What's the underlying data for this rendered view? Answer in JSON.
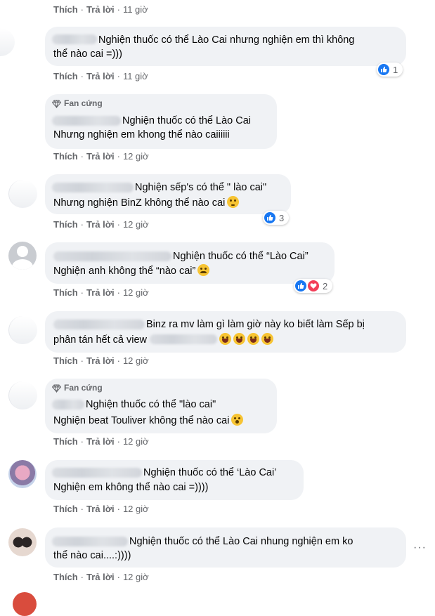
{
  "actions": {
    "like": "Thích",
    "reply": "Trả lời",
    "separator": "·"
  },
  "fan_badge": {
    "label": "Fan cứng",
    "icon": "diamond-icon"
  },
  "colors": {
    "bubble": "#f0f2f5",
    "action_text": "#65676b",
    "like_blue": "#1877f2",
    "love_red": "#f33e58",
    "emoji_yellow": "#f7c433"
  },
  "top_action": {
    "time": "11 giờ"
  },
  "comments": [
    {
      "text_lines": [
        "Nghiện thuốc có thể Lào Cai nhưng nghiện em thì không",
        "thể nào cai =)))"
      ],
      "time": "11 giờ",
      "reactions": {
        "types": [
          "like"
        ],
        "count": "1"
      }
    },
    {
      "badge": true,
      "text_lines": [
        "Nghiện thuốc có thể Lào Cai",
        "Nhưng nghiện em khong thể nào caiiiiii"
      ],
      "time": "12 giờ"
    },
    {
      "text_lines": [
        "Nghiện sếp's có thể \" lào cai\"",
        "Nhưng nghiện BinZ không thể nào cai"
      ],
      "emoji": "thinking-face",
      "time": "12 giờ",
      "reactions": {
        "types": [
          "like"
        ],
        "count": "3"
      }
    },
    {
      "text_lines": [
        "Nghiện thuốc có thể “Lào Cai”",
        "Nghiện anh không thể “nào cai”"
      ],
      "emoji": "pensive-face",
      "time": "12 giờ",
      "reactions": {
        "types": [
          "like",
          "love"
        ],
        "count": "2"
      }
    },
    {
      "text_lines": [
        "Binz ra mv làm gì làm giờ này ko biết làm Sếp bị",
        "phân tán hết cả view"
      ],
      "emoji": "rofl-face x4",
      "time": "12 giờ"
    },
    {
      "badge": true,
      "text_lines": [
        "Nghiện thuốc có thể \"lào cai\"",
        "Nghiện beat Touliver không thể nào cai"
      ],
      "emoji": "awkward-face",
      "time": "12 giờ"
    },
    {
      "text_lines": [
        "Nghiện thuốc có thể ‘Lào Cai’",
        "Nghiện em không thể nào cai =))))"
      ],
      "time": "12 giờ"
    },
    {
      "text_lines": [
        "Nghiện thuốc có thể Lào Cai nhung nghiện em ko",
        "thể nào cai....:))))"
      ],
      "time": "12 giờ"
    }
  ],
  "more_options": "···"
}
